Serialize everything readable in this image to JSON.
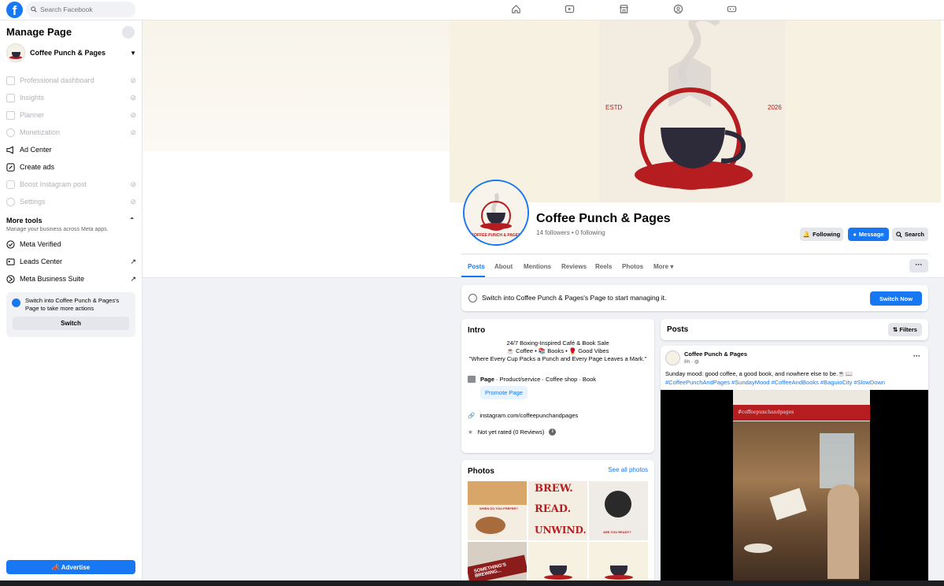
{
  "topbar": {
    "logo": "f",
    "search_placeholder": "Search Facebook",
    "nav_icons": [
      "home-icon",
      "video-icon",
      "marketplace-icon",
      "groups-icon",
      "gaming-icon"
    ]
  },
  "sidebar": {
    "title": "Manage Page",
    "page_name": "Coffee Punch & Pages",
    "items": [
      {
        "label": "Professional dashboard",
        "icon": "dashboard-icon",
        "disabled": true
      },
      {
        "label": "Insights",
        "icon": "insights-icon",
        "disabled": true
      },
      {
        "label": "Planner",
        "icon": "planner-icon",
        "disabled": true
      },
      {
        "label": "Monetization",
        "icon": "monetization-icon",
        "disabled": true
      },
      {
        "label": "Ad Center",
        "icon": "megaphone-icon",
        "disabled": false
      },
      {
        "label": "Create ads",
        "icon": "pencil-icon",
        "disabled": false
      },
      {
        "label": "Boost Instagram post",
        "icon": "instagram-icon",
        "disabled": true
      },
      {
        "label": "Settings",
        "icon": "gear-icon",
        "disabled": true
      }
    ],
    "more_tools": {
      "title": "More tools",
      "subtitle": "Manage your business across Meta apps.",
      "items": [
        {
          "label": "Meta Verified",
          "icon": "verified-icon"
        },
        {
          "label": "Leads Center",
          "icon": "leads-icon"
        },
        {
          "label": "Meta Business Suite",
          "icon": "business-suite-icon"
        }
      ]
    },
    "switch_box": {
      "text": "Switch into Coffee Punch & Pages's Page to take more actions",
      "button": "Switch"
    },
    "advertise": "Advertise"
  },
  "profile": {
    "cover_text_left": "ESTD",
    "cover_text_right": "2026",
    "pic_text": "COFFEE PUNCH & PAGES",
    "name": "Coffee Punch & Pages",
    "stats": "14 followers • 0 following",
    "buttons": {
      "following": "Following",
      "message": "Message",
      "search": "Search"
    },
    "tabs": [
      "Posts",
      "About",
      "Mentions",
      "Reviews",
      "Reels",
      "Photos",
      "More ▾"
    ]
  },
  "switch_card": {
    "text": "Switch into Coffee Punch & Pages's Page to start managing it.",
    "button": "Switch Now"
  },
  "intro": {
    "title": "Intro",
    "bio_line1": "24/7 Boxing-Inspired Café & Book Sale",
    "bio_line2": "☕ Coffee • 📚 Books • 🥊 Good Vibes",
    "bio_line3": "\"Where Every Cup Packs a Punch and Every Page Leaves a Mark.\"",
    "category_label": "Page",
    "category": " · Product/service · Coffee shop · Book",
    "promote": "Promote Page",
    "link": "instagram.com/coffeepunchandpages",
    "rating": "Not yet rated (0 Reviews)"
  },
  "photos": {
    "title": "Photos",
    "see_all": "See all photos",
    "tile_texts": [
      "WHEN DO YOU PREFER?",
      "BREW.",
      "READ.",
      "UNWIND.",
      "ARE YOU READY?",
      "SOMETHING'S BREWING..."
    ]
  },
  "posts": {
    "title": "Posts",
    "filters": "Filters",
    "post": {
      "author": "Coffee Punch & Pages",
      "time": "8h · ",
      "text": "Sunday mood: good coffee, a good book, and nowhere else to be.☕📖",
      "tags": "#CoffeePunchAndPages #SundayMood #CoffeeAndBooks #BaguioCity #SlowDown",
      "media_caption": "#coffeepunchandpages"
    }
  },
  "colors": {
    "brand": "#1877f2",
    "red": "#b51d20",
    "cream": "#f7f1e2"
  }
}
